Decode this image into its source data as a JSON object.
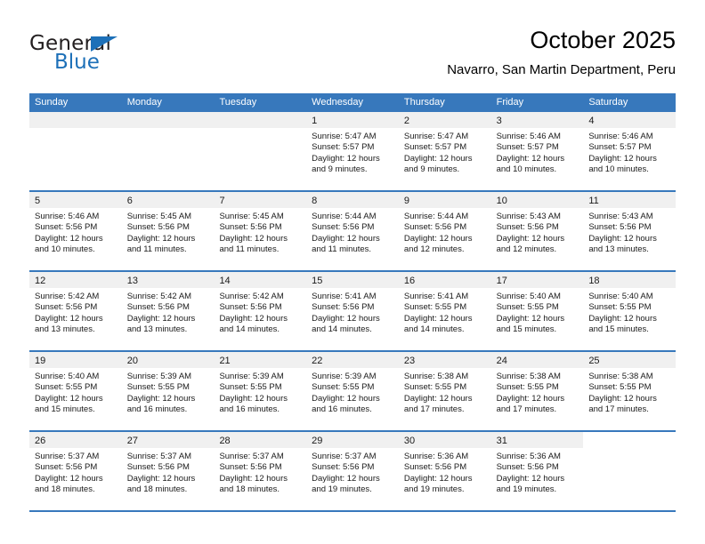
{
  "logo": {
    "word1": "General",
    "word2": "Blue",
    "triangle_color": "#1d70b8",
    "text_color": "#231f20"
  },
  "header": {
    "title": "October 2025",
    "subtitle": "Navarro, San Martin Department, Peru"
  },
  "theme": {
    "header_blue": "#3778bc",
    "daynum_band": "#f0f0f0",
    "text": "#1a1a1a"
  },
  "weekdays": [
    "Sunday",
    "Monday",
    "Tuesday",
    "Wednesday",
    "Thursday",
    "Friday",
    "Saturday"
  ],
  "labels": {
    "sunrise_prefix": "Sunrise:",
    "sunset_prefix": "Sunset:",
    "daylight_prefix": "Daylight:"
  },
  "weeks": [
    [
      {
        "day": "",
        "empty": true
      },
      {
        "day": "",
        "empty": true
      },
      {
        "day": "",
        "empty": true
      },
      {
        "day": "1",
        "sunrise": "Sunrise: 5:47 AM",
        "sunset": "Sunset: 5:57 PM",
        "daylight": "Daylight: 12 hours and 9 minutes."
      },
      {
        "day": "2",
        "sunrise": "Sunrise: 5:47 AM",
        "sunset": "Sunset: 5:57 PM",
        "daylight": "Daylight: 12 hours and 9 minutes."
      },
      {
        "day": "3",
        "sunrise": "Sunrise: 5:46 AM",
        "sunset": "Sunset: 5:57 PM",
        "daylight": "Daylight: 12 hours and 10 minutes."
      },
      {
        "day": "4",
        "sunrise": "Sunrise: 5:46 AM",
        "sunset": "Sunset: 5:57 PM",
        "daylight": "Daylight: 12 hours and 10 minutes."
      }
    ],
    [
      {
        "day": "5",
        "sunrise": "Sunrise: 5:46 AM",
        "sunset": "Sunset: 5:56 PM",
        "daylight": "Daylight: 12 hours and 10 minutes."
      },
      {
        "day": "6",
        "sunrise": "Sunrise: 5:45 AM",
        "sunset": "Sunset: 5:56 PM",
        "daylight": "Daylight: 12 hours and 11 minutes."
      },
      {
        "day": "7",
        "sunrise": "Sunrise: 5:45 AM",
        "sunset": "Sunset: 5:56 PM",
        "daylight": "Daylight: 12 hours and 11 minutes."
      },
      {
        "day": "8",
        "sunrise": "Sunrise: 5:44 AM",
        "sunset": "Sunset: 5:56 PM",
        "daylight": "Daylight: 12 hours and 11 minutes."
      },
      {
        "day": "9",
        "sunrise": "Sunrise: 5:44 AM",
        "sunset": "Sunset: 5:56 PM",
        "daylight": "Daylight: 12 hours and 12 minutes."
      },
      {
        "day": "10",
        "sunrise": "Sunrise: 5:43 AM",
        "sunset": "Sunset: 5:56 PM",
        "daylight": "Daylight: 12 hours and 12 minutes."
      },
      {
        "day": "11",
        "sunrise": "Sunrise: 5:43 AM",
        "sunset": "Sunset: 5:56 PM",
        "daylight": "Daylight: 12 hours and 13 minutes."
      }
    ],
    [
      {
        "day": "12",
        "sunrise": "Sunrise: 5:42 AM",
        "sunset": "Sunset: 5:56 PM",
        "daylight": "Daylight: 12 hours and 13 minutes."
      },
      {
        "day": "13",
        "sunrise": "Sunrise: 5:42 AM",
        "sunset": "Sunset: 5:56 PM",
        "daylight": "Daylight: 12 hours and 13 minutes."
      },
      {
        "day": "14",
        "sunrise": "Sunrise: 5:42 AM",
        "sunset": "Sunset: 5:56 PM",
        "daylight": "Daylight: 12 hours and 14 minutes."
      },
      {
        "day": "15",
        "sunrise": "Sunrise: 5:41 AM",
        "sunset": "Sunset: 5:56 PM",
        "daylight": "Daylight: 12 hours and 14 minutes."
      },
      {
        "day": "16",
        "sunrise": "Sunrise: 5:41 AM",
        "sunset": "Sunset: 5:55 PM",
        "daylight": "Daylight: 12 hours and 14 minutes."
      },
      {
        "day": "17",
        "sunrise": "Sunrise: 5:40 AM",
        "sunset": "Sunset: 5:55 PM",
        "daylight": "Daylight: 12 hours and 15 minutes."
      },
      {
        "day": "18",
        "sunrise": "Sunrise: 5:40 AM",
        "sunset": "Sunset: 5:55 PM",
        "daylight": "Daylight: 12 hours and 15 minutes."
      }
    ],
    [
      {
        "day": "19",
        "sunrise": "Sunrise: 5:40 AM",
        "sunset": "Sunset: 5:55 PM",
        "daylight": "Daylight: 12 hours and 15 minutes."
      },
      {
        "day": "20",
        "sunrise": "Sunrise: 5:39 AM",
        "sunset": "Sunset: 5:55 PM",
        "daylight": "Daylight: 12 hours and 16 minutes."
      },
      {
        "day": "21",
        "sunrise": "Sunrise: 5:39 AM",
        "sunset": "Sunset: 5:55 PM",
        "daylight": "Daylight: 12 hours and 16 minutes."
      },
      {
        "day": "22",
        "sunrise": "Sunrise: 5:39 AM",
        "sunset": "Sunset: 5:55 PM",
        "daylight": "Daylight: 12 hours and 16 minutes."
      },
      {
        "day": "23",
        "sunrise": "Sunrise: 5:38 AM",
        "sunset": "Sunset: 5:55 PM",
        "daylight": "Daylight: 12 hours and 17 minutes."
      },
      {
        "day": "24",
        "sunrise": "Sunrise: 5:38 AM",
        "sunset": "Sunset: 5:55 PM",
        "daylight": "Daylight: 12 hours and 17 minutes."
      },
      {
        "day": "25",
        "sunrise": "Sunrise: 5:38 AM",
        "sunset": "Sunset: 5:55 PM",
        "daylight": "Daylight: 12 hours and 17 minutes."
      }
    ],
    [
      {
        "day": "26",
        "sunrise": "Sunrise: 5:37 AM",
        "sunset": "Sunset: 5:56 PM",
        "daylight": "Daylight: 12 hours and 18 minutes."
      },
      {
        "day": "27",
        "sunrise": "Sunrise: 5:37 AM",
        "sunset": "Sunset: 5:56 PM",
        "daylight": "Daylight: 12 hours and 18 minutes."
      },
      {
        "day": "28",
        "sunrise": "Sunrise: 5:37 AM",
        "sunset": "Sunset: 5:56 PM",
        "daylight": "Daylight: 12 hours and 18 minutes."
      },
      {
        "day": "29",
        "sunrise": "Sunrise: 5:37 AM",
        "sunset": "Sunset: 5:56 PM",
        "daylight": "Daylight: 12 hours and 19 minutes."
      },
      {
        "day": "30",
        "sunrise": "Sunrise: 5:36 AM",
        "sunset": "Sunset: 5:56 PM",
        "daylight": "Daylight: 12 hours and 19 minutes."
      },
      {
        "day": "31",
        "sunrise": "Sunrise: 5:36 AM",
        "sunset": "Sunset: 5:56 PM",
        "daylight": "Daylight: 12 hours and 19 minutes."
      },
      {
        "day": "",
        "empty": true,
        "no_band": true
      }
    ]
  ]
}
